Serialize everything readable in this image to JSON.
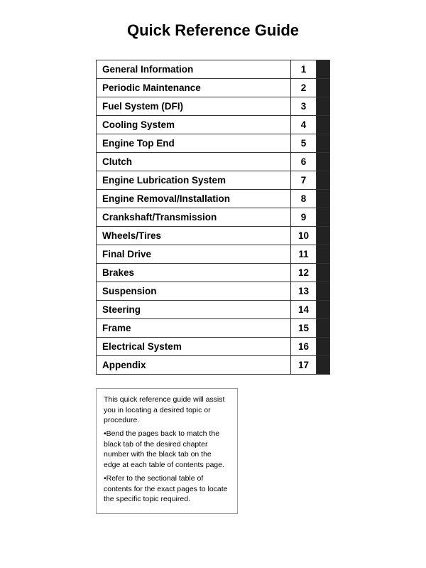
{
  "title": "Quick Reference Guide",
  "rows": [
    {
      "label": "General Information",
      "number": "1"
    },
    {
      "label": "Periodic Maintenance",
      "number": "2"
    },
    {
      "label": "Fuel System (DFI)",
      "number": "3"
    },
    {
      "label": "Cooling System",
      "number": "4"
    },
    {
      "label": "Engine Top End",
      "number": "5"
    },
    {
      "label": "Clutch",
      "number": "6"
    },
    {
      "label": "Engine Lubrication System",
      "number": "7"
    },
    {
      "label": "Engine Removal/Installation",
      "number": "8"
    },
    {
      "label": "Crankshaft/Transmission",
      "number": "9"
    },
    {
      "label": "Wheels/Tires",
      "number": "10"
    },
    {
      "label": "Final Drive",
      "number": "11"
    },
    {
      "label": "Brakes",
      "number": "12"
    },
    {
      "label": "Suspension",
      "number": "13"
    },
    {
      "label": "Steering",
      "number": "14"
    },
    {
      "label": "Frame",
      "number": "15"
    },
    {
      "label": "Electrical System",
      "number": "16"
    },
    {
      "label": "Appendix",
      "number": "17"
    }
  ],
  "note": {
    "line1": "This quick reference guide will assist you in locating a desired topic or procedure.",
    "line2": "•Bend the pages back to match the black tab of the desired chapter number with the black tab on the edge at each table of contents page.",
    "line3": "•Refer to the sectional table of contents for the exact pages to locate the specific topic required."
  }
}
